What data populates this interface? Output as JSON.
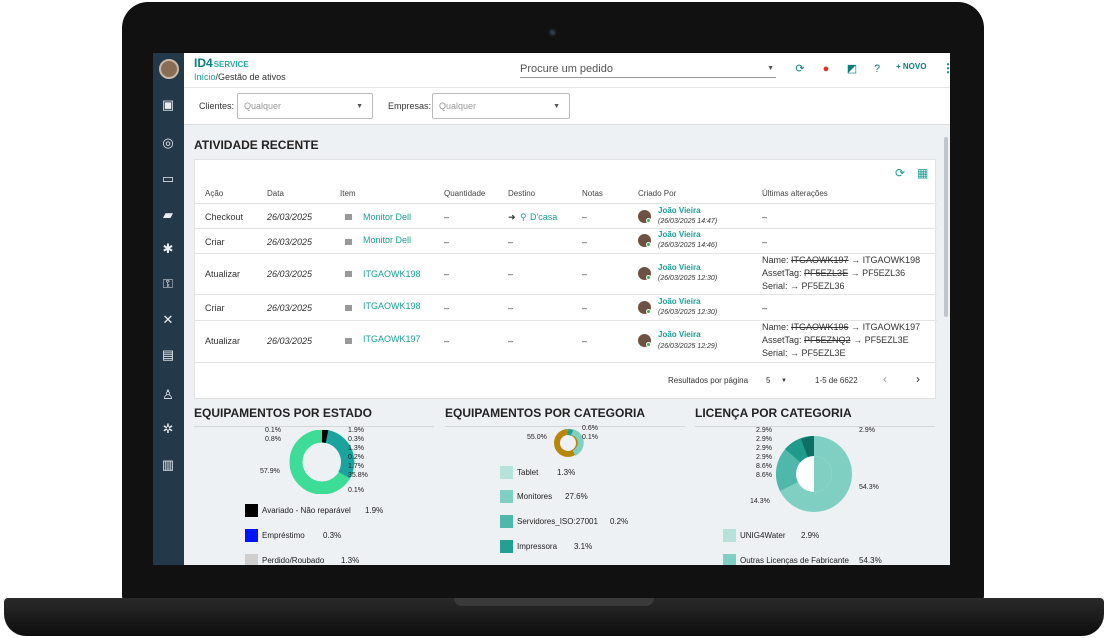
{
  "brand": {
    "logo_main": "ID4",
    "logo_sub": "SERVICE"
  },
  "breadcrumb": {
    "home": "Início",
    "sep": "/",
    "current": "Gestão de ativos"
  },
  "search": {
    "placeholder": "Procure um pedido"
  },
  "header": {
    "new_label": "+ NOVO"
  },
  "filters": {
    "clients_label": "Clientes:",
    "clients_value": "Qualquer",
    "companies_label": "Empresas:",
    "companies_value": "Qualquer"
  },
  "activity": {
    "title": "ATIVIDADE RECENTE",
    "columns": [
      "Ação",
      "Data",
      "Item",
      "Quantidade",
      "Destino",
      "Notas",
      "Criado Por",
      "Últimas alterações"
    ],
    "rows": [
      {
        "action": "Checkout",
        "date": "26/03/2025",
        "item": "Monitor Dell",
        "qty": "–",
        "dest": "D'casa",
        "notes": "–",
        "user": "João Vieira",
        "user_date": "(26/03/2025 14:47)",
        "changes": [
          "–"
        ]
      },
      {
        "action": "Criar",
        "date": "26/03/2025",
        "item": "Monitor Dell",
        "qty": "–",
        "dest": "–",
        "notes": "–",
        "user": "João Vieira",
        "user_date": "(26/03/2025 14:46)",
        "changes": [
          "–"
        ]
      },
      {
        "action": "Atualizar",
        "date": "26/03/2025",
        "item": "ITGAOWK198",
        "qty": "–",
        "dest": "–",
        "notes": "–",
        "user": "João Vieira",
        "user_date": "(26/03/2025 12:30)",
        "changes": [
          {
            "key": "Name:",
            "old": "ITGAOWK197",
            "new": "ITGAOWK198"
          },
          {
            "key": "AssetTag:",
            "old": "PF5EZL3E",
            "new": "PF5EZL36"
          },
          {
            "key": "Serial:",
            "old": "",
            "new": "PF5EZL36"
          }
        ]
      },
      {
        "action": "Criar",
        "date": "26/03/2025",
        "item": "ITGAOWK198",
        "qty": "–",
        "dest": "–",
        "notes": "–",
        "user": "João Vieira",
        "user_date": "(26/03/2025 12:30)",
        "changes": [
          "–"
        ]
      },
      {
        "action": "Atualizar",
        "date": "26/03/2025",
        "item": "ITGAOWK197",
        "qty": "–",
        "dest": "–",
        "notes": "–",
        "user": "João Vieira",
        "user_date": "(26/03/2025 12:29)",
        "changes": [
          {
            "key": "Name:",
            "old": "ITGAOWK196",
            "new": "ITGAOWK197"
          },
          {
            "key": "AssetTag:",
            "old": "PF5EZNQ2",
            "new": "PF5EZL3E"
          },
          {
            "key": "Serial:",
            "old": "",
            "new": "PF5EZL3E"
          }
        ]
      }
    ],
    "pagination": {
      "per_page_label": "Resultados por página",
      "per_page": "5",
      "range": "1-5 de 6622"
    }
  },
  "charts": {
    "estado": {
      "title": "EQUIPAMENTOS POR ESTADO"
    },
    "categoria": {
      "title": "EQUIPAMENTOS POR CATEGORIA"
    },
    "licenca": {
      "title": "LICENÇA POR CATEGORIA"
    }
  },
  "chart_data": [
    {
      "type": "pie",
      "title": "EQUIPAMENTOS POR ESTADO",
      "labels": [
        "Avariado - Não reparável",
        "Empréstimo",
        "Perdido/Roubado"
      ],
      "values_visible_legend": [
        1.9,
        0.3,
        1.3
      ],
      "slice_labels": [
        "0.1%",
        "0.8%",
        "57.9%",
        "1.9%",
        "0.3%",
        "1.3%",
        "0.2%",
        "1.7%",
        "35.8%",
        "0.1%"
      ],
      "colors": {
        "avariado": "#000000",
        "emprestimo": "#0015ff",
        "perdido": "#cccccc"
      }
    },
    {
      "type": "pie",
      "title": "EQUIPAMENTOS POR CATEGORIA",
      "labels": [
        "Tablet",
        "Monitores",
        "Servidores_ISO:27001",
        "Impressora"
      ],
      "values_visible_legend": [
        1.3,
        27.6,
        0.2,
        3.1
      ],
      "slice_labels": [
        "55.0%",
        "0.6%",
        "0.1%"
      ]
    },
    {
      "type": "pie",
      "title": "LICENÇA POR CATEGORIA",
      "labels": [
        "UNIG4Water",
        "Outras Licenças de Fabricante"
      ],
      "values_visible_legend": [
        2.9,
        54.3
      ],
      "slice_labels": [
        "2.9%",
        "2.9%",
        "2.9%",
        "2.9%",
        "8.6%",
        "8.6%",
        "14.3%",
        "54.3%",
        "2.9%"
      ]
    }
  ],
  "legend_estado": [
    {
      "label": "Avariado - Não reparável",
      "value": "1.9%",
      "color": "#000000"
    },
    {
      "label": "Empréstimo",
      "value": "0.3%",
      "color": "#0015ff"
    },
    {
      "label": "Perdido/Roubado",
      "value": "1.3%",
      "color": "#cfcfcf"
    }
  ],
  "legend_categoria": [
    {
      "label": "Tablet",
      "value": "1.3%",
      "color": "#b5e3dc"
    },
    {
      "label": "Monitores",
      "value": "27.6%",
      "color": "#7fcfc3"
    },
    {
      "label": "Servidores_ISO:27001",
      "value": "0.2%",
      "color": "#4fb8aa"
    },
    {
      "label": "Impressora",
      "value": "3.1%",
      "color": "#25a090"
    }
  ],
  "legend_licenca": [
    {
      "label": "UNIG4Water",
      "value": "2.9%",
      "color": "#b5e3dc"
    },
    {
      "label": "Outras Licenças de Fabricante",
      "value": "54.3%",
      "color": "#7fcfc3"
    }
  ]
}
